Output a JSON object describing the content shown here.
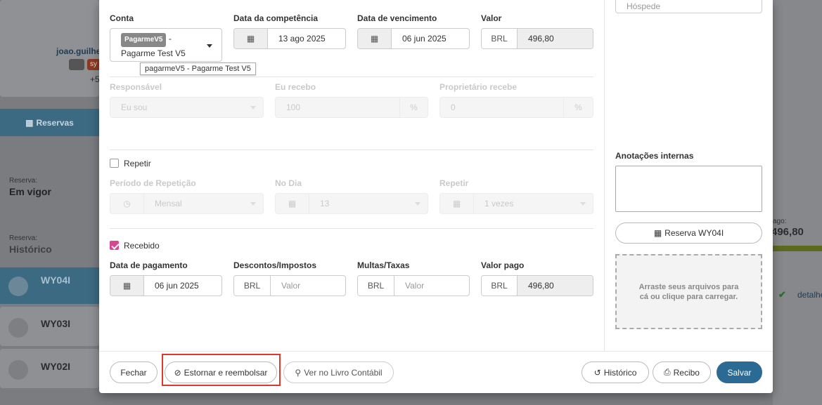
{
  "background": {
    "user_name": "joao.guilhe",
    "phone_partial": "+5",
    "tag_text": "sy",
    "reservas_tab": "Reservas",
    "status1_label": "Reserva:",
    "status1_value": "Em vigor",
    "status2_label": "Reserva:",
    "status2_value": "Histórico",
    "reservations": [
      "WY04I",
      "WY03I",
      "WY02I"
    ],
    "right_label": "ago:",
    "right_amount": "496,80",
    "right_link": "detalhe"
  },
  "form": {
    "conta": {
      "label": "Conta",
      "badge": "PagarmeV5",
      "dash": "-",
      "name": "Pagarme Test V5",
      "tooltip": "pagarmeV5 - Pagarme Test V5"
    },
    "competencia": {
      "label": "Data da competência",
      "value": "13 ago 2025"
    },
    "vencimento": {
      "label": "Data de vencimento",
      "value": "06 jun 2025"
    },
    "valor": {
      "label": "Valor",
      "currency": "BRL",
      "value": "496,80"
    },
    "responsavel": {
      "label": "Responsável",
      "value": "Eu sou"
    },
    "eu_recebo": {
      "label": "Eu recebo",
      "value": "100",
      "unit": "%"
    },
    "proprietario": {
      "label": "Proprietário recebe",
      "value": "0",
      "unit": "%"
    },
    "repetir": {
      "label": "Repetir",
      "checked": false
    },
    "periodo": {
      "label": "Período de Repetição",
      "value": "Mensal"
    },
    "no_dia": {
      "label": "No Dia",
      "value": "13"
    },
    "repetir_vezes": {
      "label": "Repetir",
      "value": "1 vezes"
    },
    "recebido": {
      "label": "Recebido",
      "checked": true
    },
    "data_pagamento": {
      "label": "Data de pagamento",
      "value": "06 jun 2025"
    },
    "descontos": {
      "label": "Descontos/Impostos",
      "currency": "BRL",
      "placeholder": "Valor"
    },
    "multas": {
      "label": "Multas/Taxas",
      "currency": "BRL",
      "placeholder": "Valor"
    },
    "valor_pago": {
      "label": "Valor pago",
      "currency": "BRL",
      "value": "496,80"
    }
  },
  "side": {
    "hospede_placeholder": "Hóspede",
    "anotacoes_label": "Anotações internas",
    "reserva_button": "Reserva WY04I",
    "dropzone_text": "Arraste seus arquivos para cá ou clique para carregar."
  },
  "footer": {
    "fechar": "Fechar",
    "estornar": "Estornar e reembolsar",
    "livro": "Ver no Livro Contábil",
    "historico": "Histórico",
    "recibo": "Recibo",
    "salvar": "Salvar"
  },
  "colors": {
    "primary": "#2a6a94",
    "checkbox": "#d6498e",
    "highlight": "#e0392b"
  }
}
